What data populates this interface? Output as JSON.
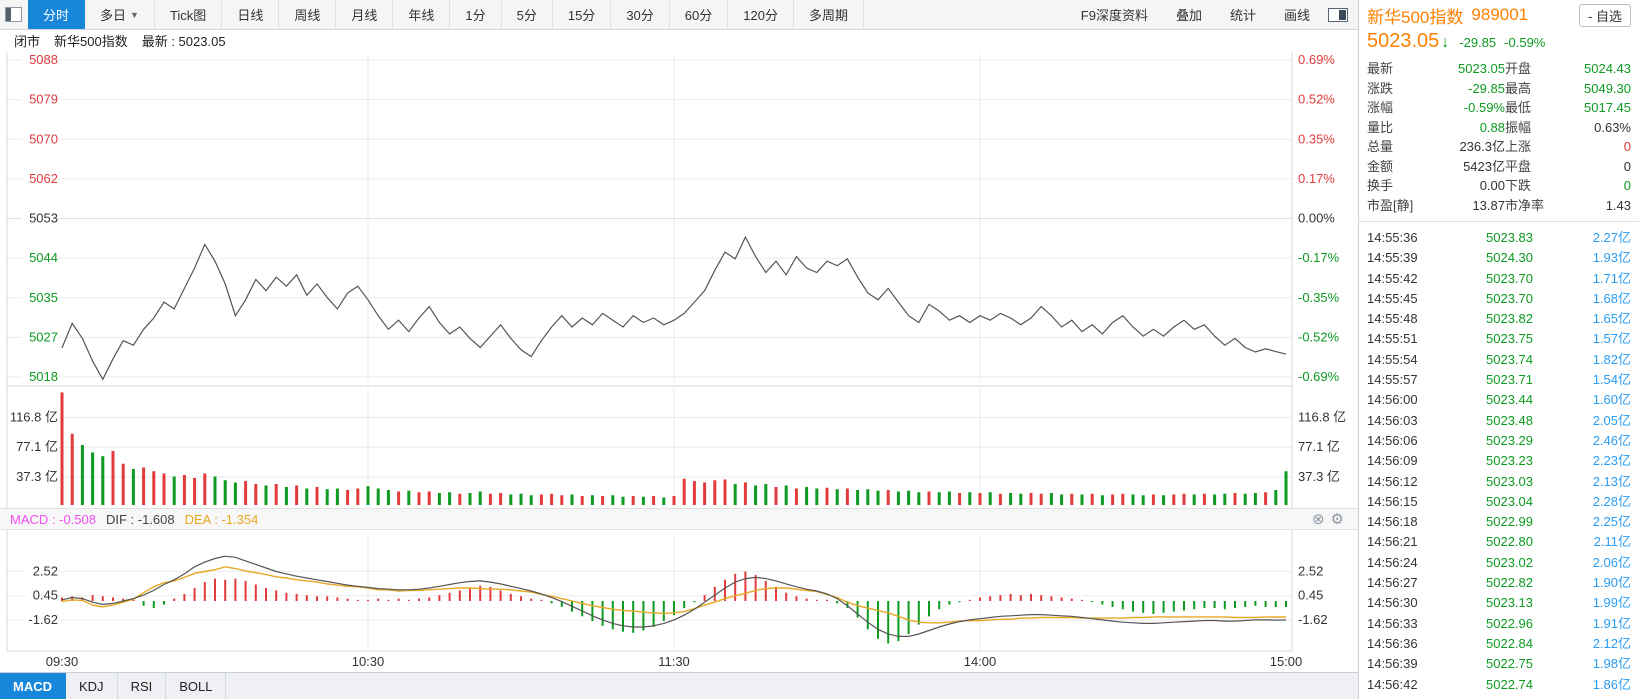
{
  "colors": {
    "red": "#e23b3c",
    "green": "#0d9b21",
    "blue": "#2a9df4",
    "orange": "#ff8000",
    "magenta": "#f14ff1",
    "dea_yellow": "#e7a823",
    "line_gray": "#555555",
    "active_blue": "#1886d9",
    "black": "#333333",
    "grid": "#ebebeb",
    "border": "#d9d9d9"
  },
  "icons": {
    "dropdown_caret": "▼",
    "down_arrow": "↓",
    "close": "⊗",
    "gear": "⚙"
  },
  "toolbar": {
    "tabs": [
      {
        "label": "分时",
        "active": true
      },
      {
        "label": "多日",
        "caret": true
      },
      {
        "label": "Tick图"
      },
      {
        "label": "日线"
      },
      {
        "label": "周线"
      },
      {
        "label": "月线"
      },
      {
        "label": "年线"
      },
      {
        "label": "1分"
      },
      {
        "label": "5分"
      },
      {
        "label": "15分"
      },
      {
        "label": "30分"
      },
      {
        "label": "60分"
      },
      {
        "label": "120分"
      },
      {
        "label": "多周期"
      }
    ],
    "actions": [
      "F9深度资料",
      "叠加",
      "统计",
      "画线"
    ]
  },
  "status_bar": {
    "market_status": "闭市",
    "index_name": "新华500指数",
    "latest": "最新 : 5023.05"
  },
  "macd_header": {
    "macd_label": "MACD : -0.508",
    "dif_label": "DIF : -1.608",
    "dea_label": "DEA : -1.354"
  },
  "indicator_tabs": [
    {
      "label": "MACD",
      "active": true
    },
    {
      "label": "KDJ"
    },
    {
      "label": "RSI"
    },
    {
      "label": "BOLL"
    }
  ],
  "quote_panel": {
    "name": "新华500指数",
    "code": "989001",
    "watchlist_button": "- 自选",
    "price": "5023.05",
    "change": "-29.85",
    "change_pct": "-0.59%",
    "fields": [
      {
        "label": "最新",
        "value": "5023.05",
        "color": "green"
      },
      {
        "label": "开盘",
        "value": "5024.43",
        "color": "green"
      },
      {
        "label": "涨跌",
        "value": "-29.85",
        "color": "green"
      },
      {
        "label": "最高",
        "value": "5049.30",
        "color": "green"
      },
      {
        "label": "涨幅",
        "value": "-0.59%",
        "color": "green"
      },
      {
        "label": "最低",
        "value": "5017.45",
        "color": "green"
      },
      {
        "label": "量比",
        "value": "0.88",
        "color": "green"
      },
      {
        "label": "振幅",
        "value": "0.63%",
        "color": "black"
      },
      {
        "label": "总量",
        "value": "236.3亿",
        "color": "black"
      },
      {
        "label": "上涨",
        "value": "0",
        "color": "red"
      },
      {
        "label": "金额",
        "value": "5423亿",
        "color": "black"
      },
      {
        "label": "平盘",
        "value": "0",
        "color": "black"
      },
      {
        "label": "换手",
        "value": "0.00",
        "color": "black"
      },
      {
        "label": "下跌",
        "value": "0",
        "color": "green"
      },
      {
        "label": "市盈[静]",
        "value": "13.87",
        "color": "black"
      },
      {
        "label": "市净率",
        "value": "1.43",
        "color": "black"
      }
    ],
    "ticks": [
      {
        "time": "14:55:36",
        "price": "5023.83",
        "vol": "2.27亿"
      },
      {
        "time": "14:55:39",
        "price": "5024.30",
        "vol": "1.93亿"
      },
      {
        "time": "14:55:42",
        "price": "5023.70",
        "vol": "1.71亿"
      },
      {
        "time": "14:55:45",
        "price": "5023.70",
        "vol": "1.68亿"
      },
      {
        "time": "14:55:48",
        "price": "5023.82",
        "vol": "1.65亿"
      },
      {
        "time": "14:55:51",
        "price": "5023.75",
        "vol": "1.57亿"
      },
      {
        "time": "14:55:54",
        "price": "5023.74",
        "vol": "1.82亿"
      },
      {
        "time": "14:55:57",
        "price": "5023.71",
        "vol": "1.54亿"
      },
      {
        "time": "14:56:00",
        "price": "5023.44",
        "vol": "1.60亿"
      },
      {
        "time": "14:56:03",
        "price": "5023.48",
        "vol": "2.05亿"
      },
      {
        "time": "14:56:06",
        "price": "5023.29",
        "vol": "2.46亿"
      },
      {
        "time": "14:56:09",
        "price": "5023.23",
        "vol": "2.23亿"
      },
      {
        "time": "14:56:12",
        "price": "5023.03",
        "vol": "2.13亿"
      },
      {
        "time": "14:56:15",
        "price": "5023.04",
        "vol": "2.28亿"
      },
      {
        "time": "14:56:18",
        "price": "5022.99",
        "vol": "2.25亿"
      },
      {
        "time": "14:56:21",
        "price": "5022.80",
        "vol": "2.11亿"
      },
      {
        "time": "14:56:24",
        "price": "5023.02",
        "vol": "2.06亿"
      },
      {
        "time": "14:56:27",
        "price": "5022.82",
        "vol": "1.90亿"
      },
      {
        "time": "14:56:30",
        "price": "5023.13",
        "vol": "1.99亿"
      },
      {
        "time": "14:56:33",
        "price": "5022.96",
        "vol": "1.91亿"
      },
      {
        "time": "14:56:36",
        "price": "5022.84",
        "vol": "2.12亿"
      },
      {
        "time": "14:56:39",
        "price": "5022.75",
        "vol": "1.98亿"
      },
      {
        "time": "14:56:42",
        "price": "5022.74",
        "vol": "1.86亿"
      }
    ]
  },
  "chart_data": {
    "type": "line",
    "title": "新华500指数 分时图",
    "prev_close": 5052.9,
    "session_minutes": 240,
    "x_labels": [
      {
        "t": "09:30",
        "m": 0
      },
      {
        "t": "10:30",
        "m": 60
      },
      {
        "t": "11:30",
        "m": 120
      },
      {
        "t": "14:00",
        "m": 180
      },
      {
        "t": "15:00",
        "m": 240
      }
    ],
    "grid_minutes": [
      60,
      120,
      180
    ],
    "price_axis_left": [
      {
        "t": "5088",
        "c": "red"
      },
      {
        "t": "5079",
        "c": "red"
      },
      {
        "t": "5070",
        "c": "red"
      },
      {
        "t": "5062",
        "c": "red"
      },
      {
        "t": "5053",
        "c": "black"
      },
      {
        "t": "5044",
        "c": "green"
      },
      {
        "t": "5035",
        "c": "green"
      },
      {
        "t": "5027",
        "c": "green"
      },
      {
        "t": "5018",
        "c": "green"
      }
    ],
    "price_axis_right": [
      {
        "t": "0.69%",
        "c": "red"
      },
      {
        "t": "0.52%",
        "c": "red"
      },
      {
        "t": "0.35%",
        "c": "red"
      },
      {
        "t": "0.17%",
        "c": "red"
      },
      {
        "t": "0.00%",
        "c": "black"
      },
      {
        "t": "-0.17%",
        "c": "green"
      },
      {
        "t": "-0.35%",
        "c": "green"
      },
      {
        "t": "-0.52%",
        "c": "green"
      },
      {
        "t": "-0.69%",
        "c": "green"
      }
    ],
    "price_axis_range": [
      5087.8,
      5018.0
    ],
    "volume_axis": [
      {
        "t": "116.8 亿",
        "v": 116.8
      },
      {
        "t": "77.1 亿",
        "v": 77.1
      },
      {
        "t": "37.3 亿",
        "v": 37.3
      }
    ],
    "macd_axis": [
      {
        "t": "2.52",
        "v": 2.52
      },
      {
        "t": "0.45",
        "v": 0.45
      },
      {
        "t": "-1.62",
        "v": -1.62
      }
    ],
    "step_minutes": 2,
    "price": [
      5024.4,
      5029.8,
      5026.5,
      5021.5,
      5017.5,
      5022.0,
      5026.0,
      5025.0,
      5028.5,
      5031.0,
      5034.5,
      5033.0,
      5037.5,
      5042.0,
      5047.2,
      5043.5,
      5038.5,
      5031.5,
      5035.0,
      5039.5,
      5037.0,
      5040.0,
      5038.0,
      5040.5,
      5036.0,
      5038.5,
      5035.5,
      5033.0,
      5036.5,
      5038.0,
      5035.0,
      5031.5,
      5028.5,
      5030.5,
      5028.0,
      5031.0,
      5033.5,
      5030.0,
      5027.5,
      5029.0,
      5026.5,
      5024.5,
      5027.0,
      5029.5,
      5026.5,
      5024.0,
      5022.5,
      5026.0,
      5029.0,
      5031.5,
      5029.0,
      5031.0,
      5029.5,
      5032.0,
      5030.5,
      5029.0,
      5031.5,
      5030.0,
      5031.0,
      5029.5,
      5030.5,
      5032.0,
      5034.5,
      5037.0,
      5041.5,
      5045.5,
      5044.0,
      5048.8,
      5044.5,
      5041.0,
      5043.5,
      5040.5,
      5044.5,
      5042.0,
      5041.0,
      5043.5,
      5042.5,
      5044.0,
      5040.0,
      5036.5,
      5035.0,
      5037.5,
      5034.5,
      5031.5,
      5030.0,
      5034.0,
      5032.5,
      5030.5,
      5031.5,
      5030.0,
      5031.5,
      5030.5,
      5032.0,
      5031.0,
      5029.5,
      5031.0,
      5033.5,
      5031.5,
      5029.0,
      5030.5,
      5028.0,
      5029.5,
      5027.5,
      5030.0,
      5031.5,
      5029.0,
      5027.0,
      5028.5,
      5027.0,
      5029.0,
      5030.5,
      5028.5,
      5029.5,
      5027.0,
      5025.0,
      5026.5,
      5024.5,
      5023.5,
      5024.2,
      5023.6,
      5023.05
    ],
    "volume": [
      150,
      95,
      80,
      70,
      65,
      72,
      55,
      48,
      50,
      45,
      42,
      38,
      40,
      36,
      42,
      38,
      33,
      30,
      32,
      28,
      26,
      28,
      24,
      26,
      22,
      24,
      21,
      22,
      20,
      22,
      25,
      22,
      20,
      18,
      19,
      17,
      18,
      16,
      17,
      15,
      16,
      18,
      15,
      16,
      14,
      15,
      13,
      14,
      15,
      13,
      14,
      12,
      13,
      12,
      13,
      11,
      12,
      11,
      12,
      10,
      12,
      35,
      32,
      30,
      33,
      34,
      28,
      30,
      26,
      28,
      24,
      26,
      22,
      24,
      22,
      23,
      21,
      22,
      20,
      21,
      19,
      20,
      18,
      19,
      17,
      18,
      17,
      18,
      16,
      17,
      16,
      17,
      15,
      16,
      15,
      16,
      15,
      16,
      14,
      15,
      14,
      15,
      13,
      14,
      15,
      14,
      13,
      14,
      13,
      14,
      15,
      14,
      15,
      14,
      15,
      16,
      15,
      16,
      17,
      20,
      45
    ],
    "dif": [
      0.1,
      0.3,
      0.2,
      -0.1,
      -0.3,
      -0.2,
      0.0,
      0.2,
      0.5,
      0.9,
      1.4,
      1.8,
      2.3,
      2.9,
      3.3,
      3.6,
      3.8,
      3.7,
      3.4,
      3.1,
      2.8,
      2.5,
      2.3,
      2.1,
      1.95,
      1.8,
      1.65,
      1.5,
      1.35,
      1.25,
      1.15,
      1.05,
      1.0,
      0.95,
      0.95,
      1.0,
      1.1,
      1.25,
      1.4,
      1.55,
      1.65,
      1.7,
      1.6,
      1.45,
      1.25,
      1.05,
      0.85,
      0.6,
      0.3,
      -0.05,
      -0.45,
      -0.85,
      -1.25,
      -1.6,
      -1.9,
      -2.1,
      -2.2,
      -2.2,
      -2.1,
      -1.9,
      -1.6,
      -1.2,
      -0.7,
      -0.1,
      0.5,
      1.1,
      1.6,
      1.9,
      2.0,
      1.9,
      1.7,
      1.45,
      1.2,
      1.0,
      0.85,
      0.6,
      0.2,
      -0.4,
      -1.1,
      -1.8,
      -2.4,
      -2.8,
      -3.0,
      -3.0,
      -2.8,
      -2.5,
      -2.2,
      -1.95,
      -1.75,
      -1.6,
      -1.5,
      -1.4,
      -1.3,
      -1.25,
      -1.2,
      -1.15,
      -1.15,
      -1.2,
      -1.25,
      -1.3,
      -1.4,
      -1.5,
      -1.6,
      -1.7,
      -1.8,
      -1.85,
      -1.9,
      -1.9,
      -1.85,
      -1.8,
      -1.75,
      -1.7,
      -1.65,
      -1.65,
      -1.7,
      -1.7,
      -1.65,
      -1.6,
      -1.6,
      -1.62,
      -1.608
    ],
    "macd_hist": [
      0.3,
      0.4,
      0.3,
      0.5,
      0.4,
      0.3,
      0.2,
      0.1,
      -0.4,
      -0.6,
      -0.3,
      0.2,
      0.6,
      1.1,
      1.6,
      1.9,
      1.8,
      1.9,
      1.7,
      1.4,
      1.1,
      0.9,
      0.7,
      0.6,
      0.5,
      0.4,
      0.4,
      0.3,
      0.2,
      0.1,
      0.1,
      0.2,
      0.1,
      0.2,
      0.1,
      0.2,
      0.3,
      0.5,
      0.7,
      0.9,
      1.1,
      1.3,
      1.2,
      0.9,
      0.6,
      0.4,
      0.2,
      0.1,
      -0.2,
      -0.5,
      -0.9,
      -1.3,
      -1.7,
      -2.1,
      -2.4,
      -2.6,
      -2.7,
      -2.5,
      -2.2,
      -1.7,
      -1.2,
      -0.6,
      -0.1,
      0.5,
      1.2,
      1.8,
      2.3,
      2.5,
      2.2,
      1.7,
      1.2,
      0.7,
      0.4,
      0.2,
      0.1,
      0.1,
      -0.2,
      -0.6,
      -1.4,
      -2.4,
      -3.2,
      -3.6,
      -3.4,
      -2.8,
      -2.0,
      -1.3,
      -0.7,
      -0.3,
      -0.1,
      0.1,
      0.3,
      0.4,
      0.5,
      0.6,
      0.5,
      0.6,
      0.5,
      0.4,
      0.3,
      0.2,
      0.1,
      -0.1,
      -0.3,
      -0.5,
      -0.7,
      -0.9,
      -1.0,
      -1.1,
      -1.0,
      -0.9,
      -0.8,
      -0.7,
      -0.6,
      -0.6,
      -0.7,
      -0.6,
      -0.5,
      -0.4,
      -0.5,
      -0.52,
      -0.508
    ]
  }
}
